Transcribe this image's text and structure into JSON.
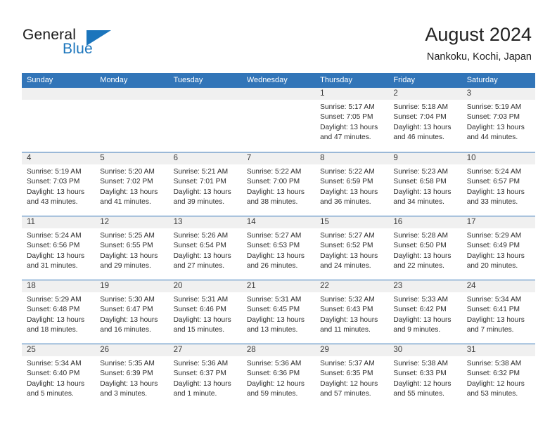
{
  "brand": {
    "word_one": "General",
    "word_two": "Blue",
    "accent_color": "#1b75bc"
  },
  "header": {
    "title": "August 2024",
    "subtitle": "Nankoku, Kochi, Japan"
  },
  "calendar": {
    "header_color": "#3275b8",
    "weekdays": [
      "Sunday",
      "Monday",
      "Tuesday",
      "Wednesday",
      "Thursday",
      "Friday",
      "Saturday"
    ],
    "weeks": [
      [
        {
          "date": "",
          "empty": true
        },
        {
          "date": "",
          "empty": true
        },
        {
          "date": "",
          "empty": true
        },
        {
          "date": "",
          "empty": true
        },
        {
          "date": "1",
          "sunrise": "Sunrise: 5:17 AM",
          "sunset": "Sunset: 7:05 PM",
          "daylight_1": "Daylight: 13 hours",
          "daylight_2": "and 47 minutes."
        },
        {
          "date": "2",
          "sunrise": "Sunrise: 5:18 AM",
          "sunset": "Sunset: 7:04 PM",
          "daylight_1": "Daylight: 13 hours",
          "daylight_2": "and 46 minutes."
        },
        {
          "date": "3",
          "sunrise": "Sunrise: 5:19 AM",
          "sunset": "Sunset: 7:03 PM",
          "daylight_1": "Daylight: 13 hours",
          "daylight_2": "and 44 minutes."
        }
      ],
      [
        {
          "date": "4",
          "sunrise": "Sunrise: 5:19 AM",
          "sunset": "Sunset: 7:03 PM",
          "daylight_1": "Daylight: 13 hours",
          "daylight_2": "and 43 minutes."
        },
        {
          "date": "5",
          "sunrise": "Sunrise: 5:20 AM",
          "sunset": "Sunset: 7:02 PM",
          "daylight_1": "Daylight: 13 hours",
          "daylight_2": "and 41 minutes."
        },
        {
          "date": "6",
          "sunrise": "Sunrise: 5:21 AM",
          "sunset": "Sunset: 7:01 PM",
          "daylight_1": "Daylight: 13 hours",
          "daylight_2": "and 39 minutes."
        },
        {
          "date": "7",
          "sunrise": "Sunrise: 5:22 AM",
          "sunset": "Sunset: 7:00 PM",
          "daylight_1": "Daylight: 13 hours",
          "daylight_2": "and 38 minutes."
        },
        {
          "date": "8",
          "sunrise": "Sunrise: 5:22 AM",
          "sunset": "Sunset: 6:59 PM",
          "daylight_1": "Daylight: 13 hours",
          "daylight_2": "and 36 minutes."
        },
        {
          "date": "9",
          "sunrise": "Sunrise: 5:23 AM",
          "sunset": "Sunset: 6:58 PM",
          "daylight_1": "Daylight: 13 hours",
          "daylight_2": "and 34 minutes."
        },
        {
          "date": "10",
          "sunrise": "Sunrise: 5:24 AM",
          "sunset": "Sunset: 6:57 PM",
          "daylight_1": "Daylight: 13 hours",
          "daylight_2": "and 33 minutes."
        }
      ],
      [
        {
          "date": "11",
          "sunrise": "Sunrise: 5:24 AM",
          "sunset": "Sunset: 6:56 PM",
          "daylight_1": "Daylight: 13 hours",
          "daylight_2": "and 31 minutes."
        },
        {
          "date": "12",
          "sunrise": "Sunrise: 5:25 AM",
          "sunset": "Sunset: 6:55 PM",
          "daylight_1": "Daylight: 13 hours",
          "daylight_2": "and 29 minutes."
        },
        {
          "date": "13",
          "sunrise": "Sunrise: 5:26 AM",
          "sunset": "Sunset: 6:54 PM",
          "daylight_1": "Daylight: 13 hours",
          "daylight_2": "and 27 minutes."
        },
        {
          "date": "14",
          "sunrise": "Sunrise: 5:27 AM",
          "sunset": "Sunset: 6:53 PM",
          "daylight_1": "Daylight: 13 hours",
          "daylight_2": "and 26 minutes."
        },
        {
          "date": "15",
          "sunrise": "Sunrise: 5:27 AM",
          "sunset": "Sunset: 6:52 PM",
          "daylight_1": "Daylight: 13 hours",
          "daylight_2": "and 24 minutes."
        },
        {
          "date": "16",
          "sunrise": "Sunrise: 5:28 AM",
          "sunset": "Sunset: 6:50 PM",
          "daylight_1": "Daylight: 13 hours",
          "daylight_2": "and 22 minutes."
        },
        {
          "date": "17",
          "sunrise": "Sunrise: 5:29 AM",
          "sunset": "Sunset: 6:49 PM",
          "daylight_1": "Daylight: 13 hours",
          "daylight_2": "and 20 minutes."
        }
      ],
      [
        {
          "date": "18",
          "sunrise": "Sunrise: 5:29 AM",
          "sunset": "Sunset: 6:48 PM",
          "daylight_1": "Daylight: 13 hours",
          "daylight_2": "and 18 minutes."
        },
        {
          "date": "19",
          "sunrise": "Sunrise: 5:30 AM",
          "sunset": "Sunset: 6:47 PM",
          "daylight_1": "Daylight: 13 hours",
          "daylight_2": "and 16 minutes."
        },
        {
          "date": "20",
          "sunrise": "Sunrise: 5:31 AM",
          "sunset": "Sunset: 6:46 PM",
          "daylight_1": "Daylight: 13 hours",
          "daylight_2": "and 15 minutes."
        },
        {
          "date": "21",
          "sunrise": "Sunrise: 5:31 AM",
          "sunset": "Sunset: 6:45 PM",
          "daylight_1": "Daylight: 13 hours",
          "daylight_2": "and 13 minutes."
        },
        {
          "date": "22",
          "sunrise": "Sunrise: 5:32 AM",
          "sunset": "Sunset: 6:43 PM",
          "daylight_1": "Daylight: 13 hours",
          "daylight_2": "and 11 minutes."
        },
        {
          "date": "23",
          "sunrise": "Sunrise: 5:33 AM",
          "sunset": "Sunset: 6:42 PM",
          "daylight_1": "Daylight: 13 hours",
          "daylight_2": "and 9 minutes."
        },
        {
          "date": "24",
          "sunrise": "Sunrise: 5:34 AM",
          "sunset": "Sunset: 6:41 PM",
          "daylight_1": "Daylight: 13 hours",
          "daylight_2": "and 7 minutes."
        }
      ],
      [
        {
          "date": "25",
          "sunrise": "Sunrise: 5:34 AM",
          "sunset": "Sunset: 6:40 PM",
          "daylight_1": "Daylight: 13 hours",
          "daylight_2": "and 5 minutes."
        },
        {
          "date": "26",
          "sunrise": "Sunrise: 5:35 AM",
          "sunset": "Sunset: 6:39 PM",
          "daylight_1": "Daylight: 13 hours",
          "daylight_2": "and 3 minutes."
        },
        {
          "date": "27",
          "sunrise": "Sunrise: 5:36 AM",
          "sunset": "Sunset: 6:37 PM",
          "daylight_1": "Daylight: 13 hours",
          "daylight_2": "and 1 minute."
        },
        {
          "date": "28",
          "sunrise": "Sunrise: 5:36 AM",
          "sunset": "Sunset: 6:36 PM",
          "daylight_1": "Daylight: 12 hours",
          "daylight_2": "and 59 minutes."
        },
        {
          "date": "29",
          "sunrise": "Sunrise: 5:37 AM",
          "sunset": "Sunset: 6:35 PM",
          "daylight_1": "Daylight: 12 hours",
          "daylight_2": "and 57 minutes."
        },
        {
          "date": "30",
          "sunrise": "Sunrise: 5:38 AM",
          "sunset": "Sunset: 6:33 PM",
          "daylight_1": "Daylight: 12 hours",
          "daylight_2": "and 55 minutes."
        },
        {
          "date": "31",
          "sunrise": "Sunrise: 5:38 AM",
          "sunset": "Sunset: 6:32 PM",
          "daylight_1": "Daylight: 12 hours",
          "daylight_2": "and 53 minutes."
        }
      ]
    ]
  }
}
